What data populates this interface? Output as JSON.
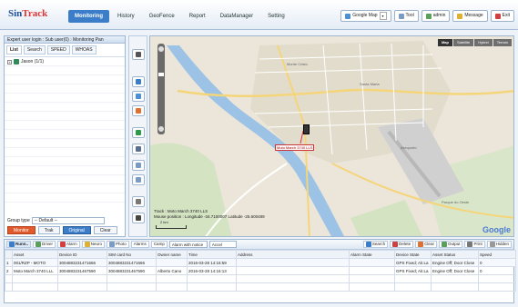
{
  "app": {
    "logo_1": "Sin",
    "logo_2": "Track"
  },
  "nav": [
    "Monitoring",
    "History",
    "GeoFence",
    "Report",
    "DataManager",
    "Setting"
  ],
  "nav_active": 0,
  "toolbar": {
    "map": "Google Map",
    "tool": "Tool",
    "user": "admin",
    "message": "Message",
    "exit": "Exit"
  },
  "left": {
    "title": "Expert user login : Sub user(0) : Monitoring Pan",
    "tabs": [
      "List",
      "Search",
      "SPEED",
      "WHOAS"
    ],
    "tree_root": "Jason (1/1)",
    "group_label": "Group type",
    "group_value": "-- Default --",
    "buttons": [
      "Monitor",
      "Trak",
      "Original",
      "Clear"
    ]
  },
  "map": {
    "types": [
      "Map",
      "Satellite",
      "Hybrid",
      "Terrain"
    ],
    "track_line1": "Track : Moto March 3740 LLS",
    "track_line2": "Mouse position : Longitude -34.7100007 Latitude -25.600489",
    "scale": "2 km",
    "car_label": "Moto March 3740 LLS",
    "google": "Google",
    "place_labels": [
      "Monte Cristo",
      "Santa Maria",
      "Aeroporto",
      "Parque do Oeste"
    ]
  },
  "bottom": {
    "tabs": [
      "Runn..",
      "Driver",
      "Alarm",
      "Neuro",
      "Photo",
      "Alarms",
      "Camp"
    ],
    "filter_1": "Alarm with notice",
    "filter_2": "Accel",
    "actions": [
      "Search",
      "Delete",
      "Clear",
      "Output",
      "Print",
      "Hidden"
    ]
  },
  "table": {
    "headers": [
      "",
      "Asset",
      "Device ID",
      "SIM card No",
      "Owner name",
      "Time",
      "Address",
      "Alarm State",
      "Device State",
      "Asset Status",
      "Speed"
    ],
    "rows": [
      [
        "1",
        "001/RZP - MOTO",
        "3004883231471666",
        "3004883231471666",
        "",
        "2016-03-28 14:16:59",
        "",
        "",
        "GPS Fixed; Alr.La",
        "Engine Off; Door Close",
        "0"
      ],
      [
        "2",
        "Moto March 3740 LLL",
        "3004883231467590",
        "3004883231467590",
        "Alberto Cano",
        "2016-03-28 14:16:13",
        "",
        "",
        "GPS Fixed; Alr.La",
        "Engine Off; Door Close",
        "0"
      ]
    ]
  }
}
